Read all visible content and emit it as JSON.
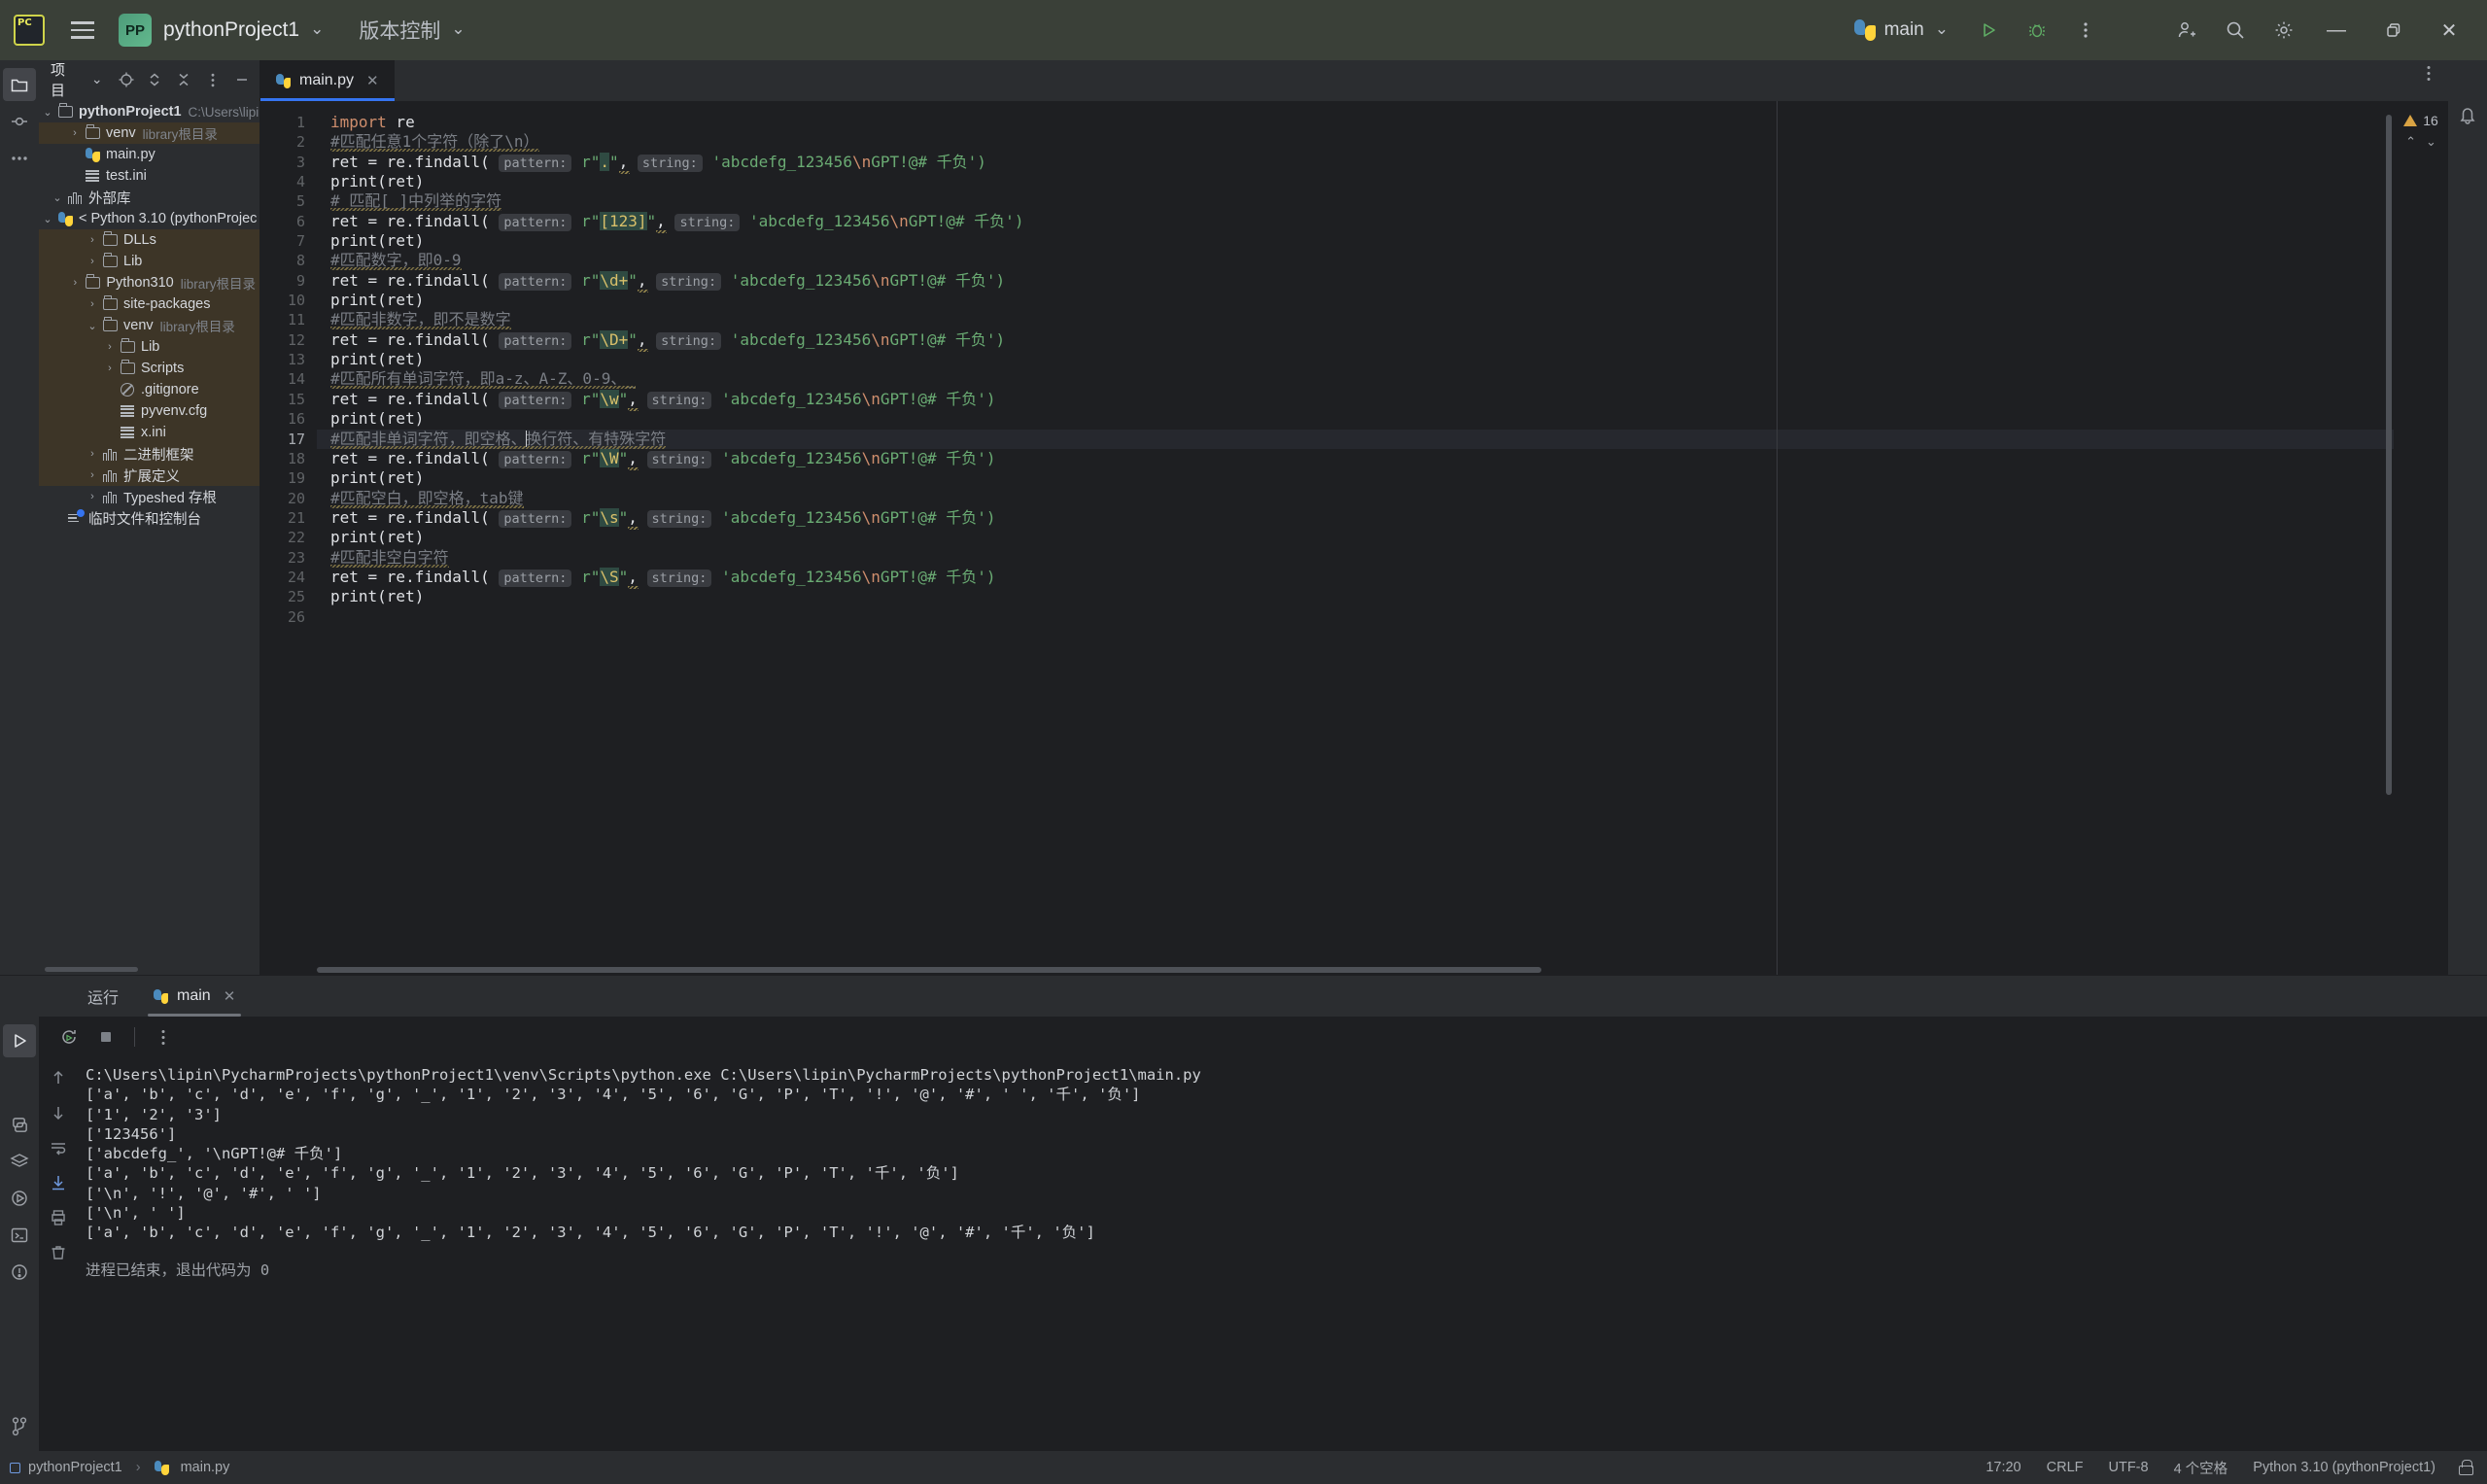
{
  "titlebar": {
    "logo_alt": "PC",
    "project_badge": "PP",
    "project_name": "pythonProject1",
    "vcs_label": "版本控制",
    "run_config_name": "main",
    "menu_icon": "hamburger-icon",
    "run_icon": "run-icon",
    "debug_icon": "debug-icon",
    "more_icon": "more-vertical-icon",
    "account_icon": "add-user-icon",
    "search_icon": "search-icon",
    "settings_icon": "gear-icon",
    "minimize": "—",
    "maximize": "❐",
    "close": "✕"
  },
  "rail": {
    "items": [
      {
        "name": "project-tool-window",
        "icon": "folder-icon"
      },
      {
        "name": "commit-tool-window",
        "icon": "commit-icon"
      },
      {
        "name": "more-tool-windows",
        "icon": "ellipsis-icon"
      }
    ],
    "bottom": [
      {
        "name": "run-tool-window",
        "icon": "run-triangle-icon"
      },
      {
        "name": "python-console",
        "icon": "python-icon"
      },
      {
        "name": "services",
        "icon": "layers-icon"
      },
      {
        "name": "debug-tool-window",
        "icon": "debug-run-icon"
      },
      {
        "name": "terminal",
        "icon": "terminal-icon"
      },
      {
        "name": "problems",
        "icon": "warning-circle-icon"
      },
      {
        "name": "version-control",
        "icon": "branch-icon"
      }
    ]
  },
  "project_panel": {
    "title": "项目",
    "toolbar_icons": [
      "target-icon",
      "expand-collapse-icon",
      "collapse-all-icon",
      "options-icon",
      "hide-icon"
    ],
    "tree": [
      {
        "depth": 0,
        "arrow": "down",
        "icon": "folder",
        "label": "pythonProject1",
        "bold": true,
        "dim": "C:\\Users\\lipin",
        "state": "normal"
      },
      {
        "depth": 1,
        "arrow": "right",
        "icon": "folder",
        "label": "venv",
        "bold": false,
        "dim": "library根目录",
        "state": "highlight"
      },
      {
        "depth": 1,
        "arrow": "none",
        "icon": "python",
        "label": "main.py",
        "bold": false,
        "dim": "",
        "state": "normal"
      },
      {
        "depth": 1,
        "arrow": "none",
        "icon": "ini",
        "label": "test.ini",
        "bold": false,
        "dim": "",
        "state": "normal"
      },
      {
        "depth": 0,
        "arrow": "down",
        "icon": "lib",
        "label": "外部库",
        "bold": false,
        "dim": "",
        "state": "normal"
      },
      {
        "depth": 1,
        "arrow": "down",
        "icon": "python",
        "label": "< Python 3.10 (pythonProjec",
        "bold": false,
        "dim": "",
        "state": "normal"
      },
      {
        "depth": 2,
        "arrow": "right",
        "icon": "folder",
        "label": "DLLs",
        "bold": false,
        "dim": "",
        "state": "highlight"
      },
      {
        "depth": 2,
        "arrow": "right",
        "icon": "folder",
        "label": "Lib",
        "bold": false,
        "dim": "",
        "state": "highlight"
      },
      {
        "depth": 2,
        "arrow": "right",
        "icon": "folder",
        "label": "Python310",
        "bold": false,
        "dim": "library根目录",
        "state": "highlight"
      },
      {
        "depth": 2,
        "arrow": "right",
        "icon": "folder",
        "label": "site-packages",
        "bold": false,
        "dim": "",
        "state": "highlight"
      },
      {
        "depth": 2,
        "arrow": "down",
        "icon": "folder",
        "label": "venv",
        "bold": false,
        "dim": "library根目录",
        "state": "highlight"
      },
      {
        "depth": 3,
        "arrow": "right",
        "icon": "folder",
        "label": "Lib",
        "bold": false,
        "dim": "",
        "state": "highlight"
      },
      {
        "depth": 3,
        "arrow": "right",
        "icon": "folder",
        "label": "Scripts",
        "bold": false,
        "dim": "",
        "state": "highlight"
      },
      {
        "depth": 3,
        "arrow": "none",
        "icon": "gitignore",
        "label": ".gitignore",
        "bold": false,
        "dim": "",
        "state": "highlight"
      },
      {
        "depth": 3,
        "arrow": "none",
        "icon": "ini",
        "label": "pyvenv.cfg",
        "bold": false,
        "dim": "",
        "state": "highlight"
      },
      {
        "depth": 3,
        "arrow": "none",
        "icon": "ini",
        "label": "x.ini",
        "bold": false,
        "dim": "",
        "state": "highlight"
      },
      {
        "depth": 2,
        "arrow": "right",
        "icon": "lib",
        "label": "二进制框架",
        "bold": false,
        "dim": "",
        "state": "highlight"
      },
      {
        "depth": 2,
        "arrow": "right",
        "icon": "lib",
        "label": "扩展定义",
        "bold": false,
        "dim": "",
        "state": "highlight"
      },
      {
        "depth": 2,
        "arrow": "right",
        "icon": "lib",
        "label": "Typeshed 存根",
        "bold": false,
        "dim": "",
        "state": "normal"
      },
      {
        "depth": 0,
        "arrow": "none",
        "icon": "scratch",
        "label": "临时文件和控制台",
        "bold": false,
        "dim": "",
        "state": "normal"
      }
    ]
  },
  "editor": {
    "tab": {
      "label": "main.py",
      "icon": "python-icon",
      "close": "✕"
    },
    "more_icon": "more-vertical-icon",
    "inspection": {
      "count": "16",
      "icon": "warning-triangle-icon",
      "up": "⌃",
      "down": "⌄"
    },
    "line_numbers": [
      "1",
      "2",
      "3",
      "4",
      "5",
      "6",
      "7",
      "8",
      "9",
      "10",
      "11",
      "12",
      "13",
      "14",
      "15",
      "16",
      "17",
      "18",
      "19",
      "20",
      "21",
      "22",
      "23",
      "24",
      "25",
      "26"
    ],
    "current_line": 17,
    "code": {
      "l1_import": "import",
      "l1_mod": " re",
      "l2_comment": "#匹配任意1个字符（除了\\n）",
      "l3_pattern": ".",
      "l5_comment": "# 匹配[ ]中列举的字符",
      "l6_pattern": "[123]",
      "l8_comment": "#匹配数字，即0-9",
      "l9_pattern": "\\d+",
      "l11_comment": "#匹配非数字，即不是数字",
      "l12_pattern": "\\D+",
      "l14_comment": "#匹配所有单词字符，即a-z、A-Z、0-9、_",
      "l15_pattern": "\\w",
      "l17_comment": "#匹配非单词字符，即空格、换行符、有特殊字符",
      "l18_pattern": "\\W",
      "l20_comment": "#匹配空白，即空格，tab键",
      "l21_pattern": "\\s",
      "l23_comment": "#匹配非空白字符",
      "l24_pattern": "\\S",
      "assign": "ret = re.findall( ",
      "hint_pattern": "pattern:",
      "hint_string": "string:",
      "string_arg": "'abcdefg_123456\\nGPT!@# 千负')",
      "print_call": "print(ret)",
      "r_prefix": "r\"",
      "quote_comma": "\", "
    }
  },
  "run_panel": {
    "tab_run": "运行",
    "tab_main": "main",
    "tab_main_close": "✕",
    "toolbar": {
      "rerun": "rerun-icon",
      "stop": "stop-icon",
      "more": "more-vertical-icon"
    },
    "side_icons": [
      "arrow-up-icon",
      "arrow-down-icon",
      "soft-wrap-icon",
      "scroll-to-end-icon",
      "print-icon",
      "clear-all-icon"
    ],
    "console_lines": [
      "C:\\Users\\lipin\\PycharmProjects\\pythonProject1\\venv\\Scripts\\python.exe C:\\Users\\lipin\\PycharmProjects\\pythonProject1\\main.py",
      "['a', 'b', 'c', 'd', 'e', 'f', 'g', '_', '1', '2', '3', '4', '5', '6', 'G', 'P', 'T', '!', '@', '#', ' ', '千', '负']",
      "['1', '2', '3']",
      "['123456']",
      "['abcdefg_', '\\nGPT!@# 千负']",
      "['a', 'b', 'c', 'd', 'e', 'f', 'g', '_', '1', '2', '3', '4', '5', '6', 'G', 'P', 'T', '千', '负']",
      "['\\n', '!', '@', '#', ' ']",
      "['\\n', ' ']",
      "['a', 'b', 'c', 'd', 'e', 'f', 'g', '_', '1', '2', '3', '4', '5', '6', 'G', 'P', 'T', '!', '@', '#', '千', '负']"
    ],
    "exit_message": "进程已结束，退出代码为 0"
  },
  "statusbar": {
    "breadcrumb_project": "pythonProject1",
    "breadcrumb_sep": "›",
    "breadcrumb_file": "main.py",
    "caret_position": "17:20",
    "line_separator": "CRLF",
    "encoding": "UTF-8",
    "indent": "4 个空格",
    "interpreter": "Python 3.10 (pythonProject1)",
    "lock_icon": "unlocked-icon"
  },
  "colors": {
    "accent": "#3574f0",
    "titlebar_bg": "#3a4038",
    "panel_bg": "#2b2d30",
    "editor_bg": "#1e1f22",
    "highlight_row": "#3d3527",
    "string_green": "#6aab73",
    "keyword_orange": "#cf8e6d",
    "comment_gray": "#7a7e85"
  }
}
